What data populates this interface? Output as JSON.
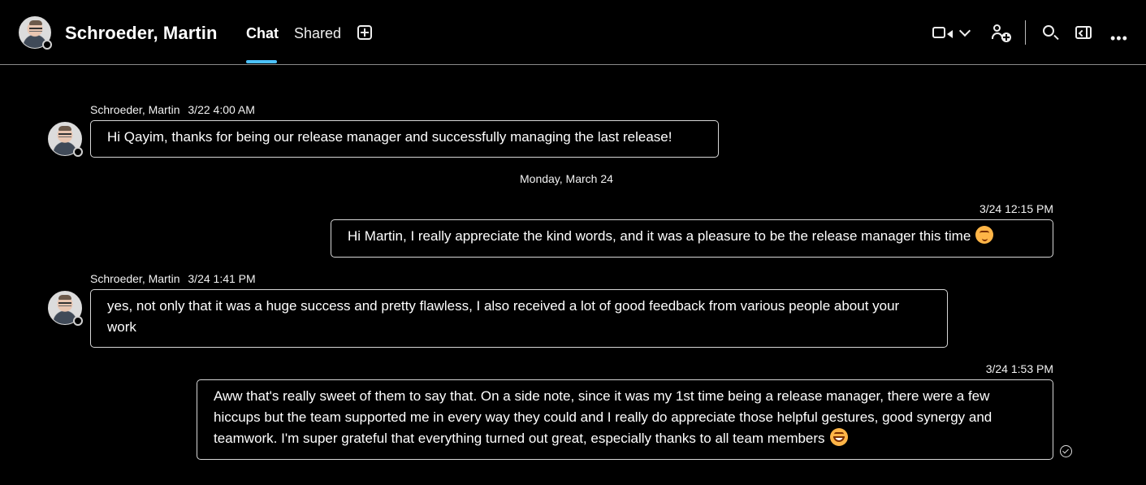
{
  "header": {
    "contact_name": "Schroeder, Martin",
    "tabs": [
      {
        "label": "Chat",
        "active": true
      },
      {
        "label": "Shared",
        "active": false
      }
    ],
    "icons": [
      "add-tab-icon",
      "video-call-icon",
      "chevron-down-icon",
      "add-people-icon",
      "search-icon",
      "side-panel-icon",
      "more-options-icon"
    ],
    "accent_color": "#4cc2ff"
  },
  "conversation": {
    "messages": [
      {
        "direction": "incoming",
        "sender": "Schroeder, Martin",
        "time": "3/22 4:00 AM",
        "text": "Hi Qayim, thanks for being our release manager and successfully managing the last release!"
      },
      {
        "separator": "Monday, March 24"
      },
      {
        "direction": "outgoing",
        "time": "3/24 12:15 PM",
        "text": "Hi Martin, I really appreciate the kind words, and it was a pleasure to be the release manager this time",
        "emoji": "blushing-smile"
      },
      {
        "direction": "incoming",
        "sender": "Schroeder, Martin",
        "time": "3/24 1:41 PM",
        "text": "yes, not only that it was a huge success and pretty flawless, I also received a lot of good feedback from various people about your work"
      },
      {
        "direction": "outgoing",
        "time": "3/24 1:53 PM",
        "text": "Aww that's really sweet of them to say that. On a side note, since it was my 1st time being a release manager, there were a few hiccups but the team supported me in every way they could and I really do appreciate those helpful gestures, good synergy and teamwork. I'm super grateful that everything turned out great, especially thanks to all team members",
        "emoji": "grinning",
        "read_status": "seen"
      }
    ]
  }
}
